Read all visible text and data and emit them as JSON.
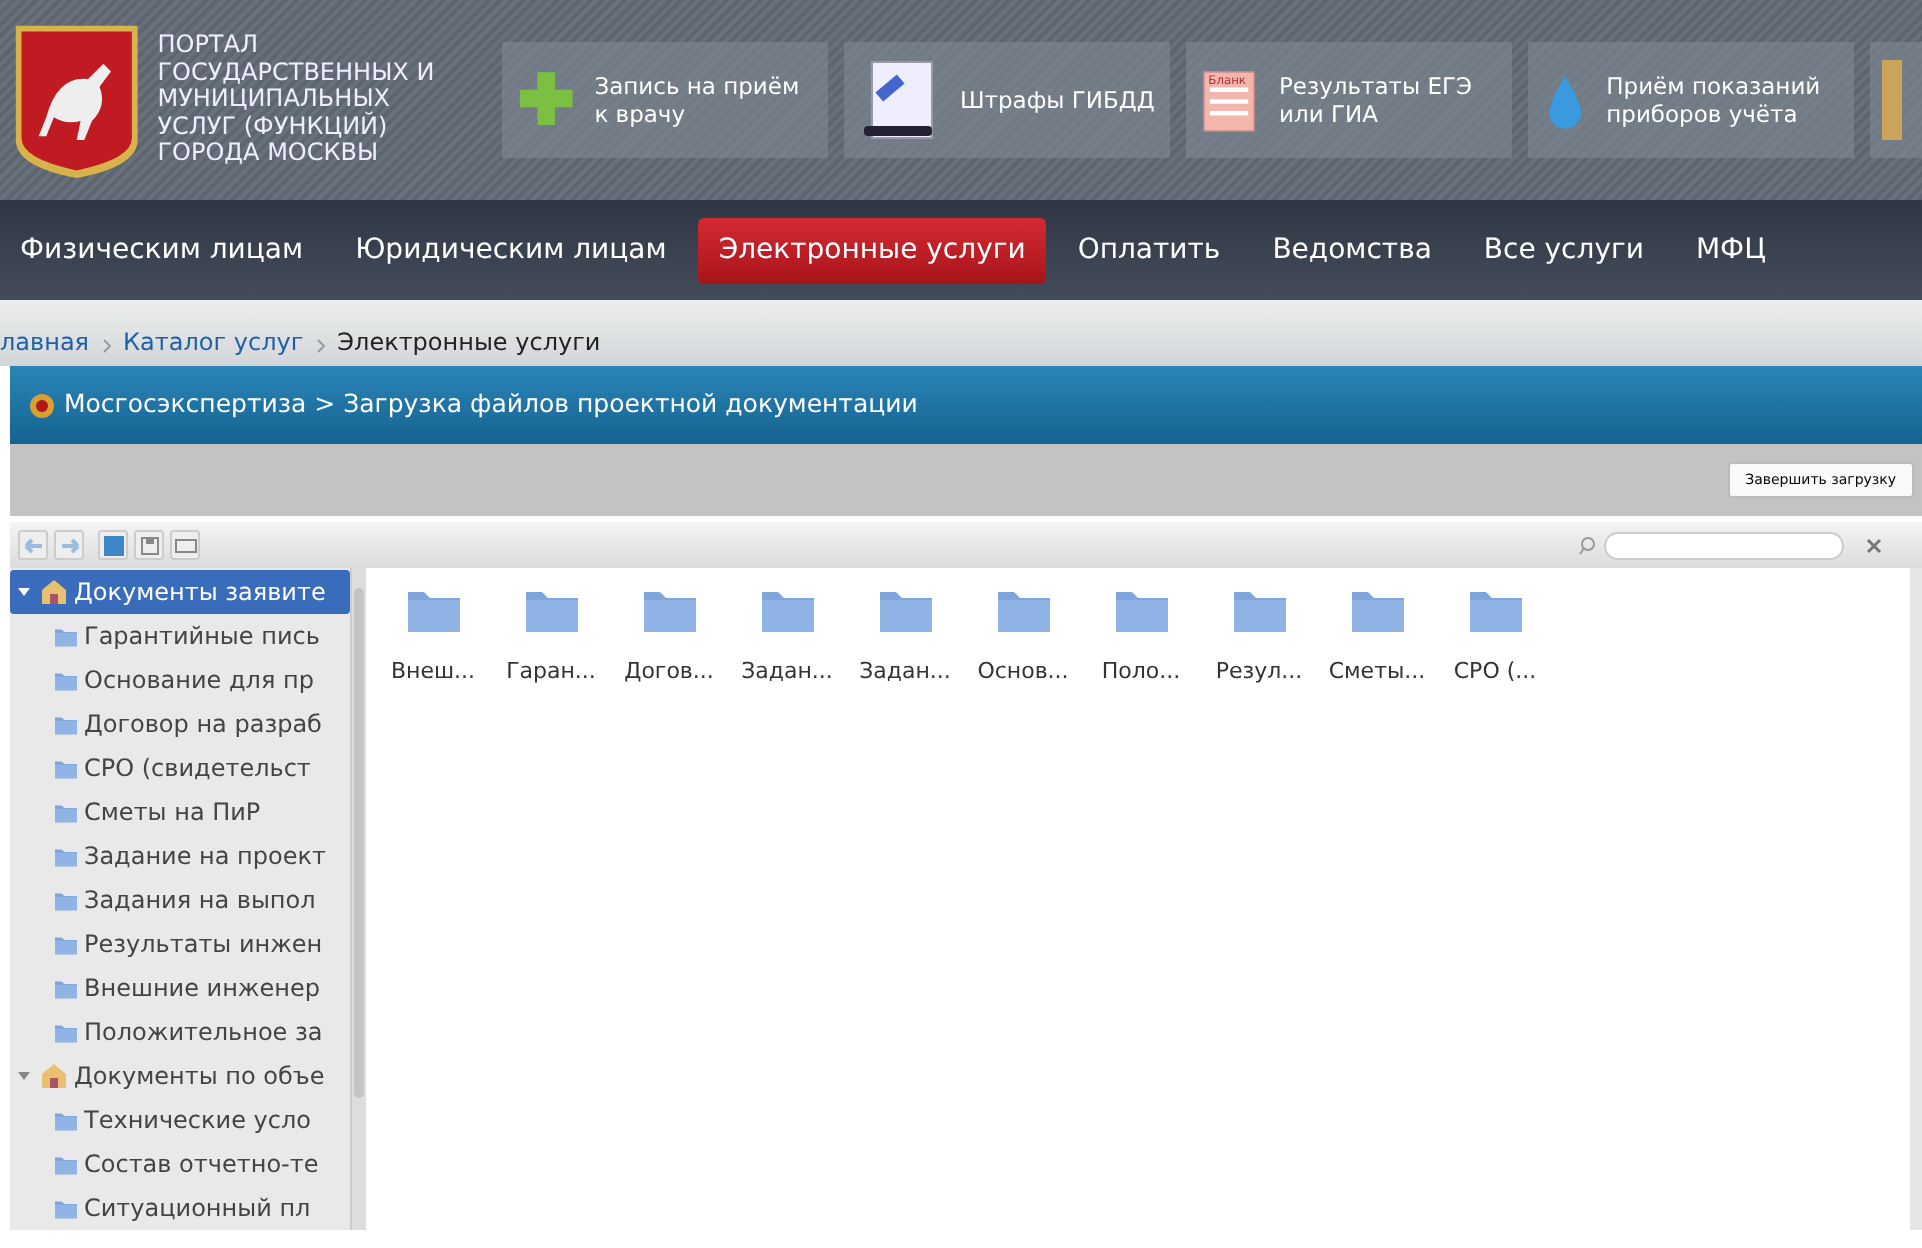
{
  "portal": {
    "title_lines": [
      "ПОРТАЛ",
      "ГОСУДАРСТВЕННЫХ И",
      "МУНИЦИПАЛЬНЫХ",
      "УСЛУГ (ФУНКЦИЙ)",
      "ГОРОДА МОСКВЫ"
    ]
  },
  "quick_links": [
    {
      "kind": "cross",
      "label": "Запись на приём к врачу"
    },
    {
      "kind": "fine",
      "label": "Штрафы ГИБДД"
    },
    {
      "kind": "form",
      "label": "Результаты ЕГЭ или ГИА",
      "icon_text": "Бланк"
    },
    {
      "kind": "drop",
      "label": "Приём показаний приборов учёта"
    }
  ],
  "nav": [
    {
      "label": "Физическим лицам",
      "selected": false
    },
    {
      "label": "Юридическим лицам",
      "selected": false
    },
    {
      "label": "Электронные услуги",
      "selected": true
    },
    {
      "label": "Оплатить",
      "selected": false
    },
    {
      "label": "Ведомства",
      "selected": false
    },
    {
      "label": "Все услуги",
      "selected": false
    },
    {
      "label": "МФЦ",
      "selected": false
    }
  ],
  "breadcrumbs": [
    {
      "label": "лавная",
      "link": true
    },
    {
      "label": "Каталог услуг",
      "link": true
    },
    {
      "label": "Электронные услуги",
      "link": false
    }
  ],
  "window": {
    "title": "Мосгосэкспертиза > Загрузка файлов проектной документации",
    "finish_button": "Завершить загрузку"
  },
  "tree": [
    {
      "label": "Документы заявите",
      "selected": true,
      "expanded": true,
      "children": [
        {
          "label": "Гарантийные пись"
        },
        {
          "label": "Основание для пр"
        },
        {
          "label": "Договор на разраб"
        },
        {
          "label": "СРО (свидетельст"
        },
        {
          "label": "Сметы на ПиР"
        },
        {
          "label": "Задание на проект"
        },
        {
          "label": "Задания на выпол"
        },
        {
          "label": "Результаты инжен"
        },
        {
          "label": "Внешние инженер"
        },
        {
          "label": "Положительное за"
        }
      ]
    },
    {
      "label": "Документы по объе",
      "selected": false,
      "expanded": true,
      "children": [
        {
          "label": "Технические усло"
        },
        {
          "label": "Состав отчетно-те"
        },
        {
          "label": "Ситуационный пл"
        }
      ]
    }
  ],
  "folders": [
    "Внеш...",
    "Гаран...",
    "Догов...",
    "Задан...",
    "Задан...",
    "Основ...",
    "Поло...",
    "Резул...",
    "Сметы...",
    "СРО (..."
  ]
}
